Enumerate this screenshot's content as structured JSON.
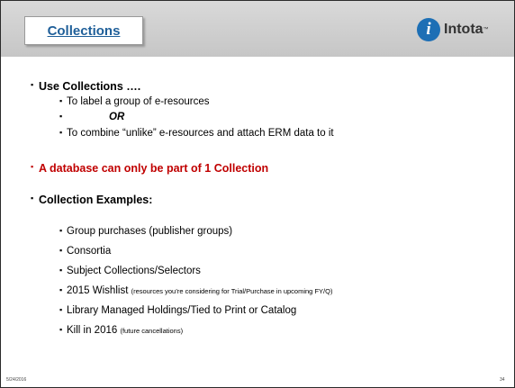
{
  "header": {
    "title": "Collections",
    "logo_text": "Intota",
    "logo_tm": "™",
    "logo_icon": "info-i"
  },
  "bullets": [
    {
      "text": "Use Collections ….",
      "color": "#000000"
    },
    {
      "sub": [
        {
          "text": "To label a group of e-resources"
        },
        {
          "text": "OR"
        },
        {
          "text": "To combine “unlike” e-resources  and attach ERM data to it"
        }
      ]
    },
    {
      "text": "A database can only be part of 1 Collection",
      "color": "#c00000"
    },
    {
      "text": "Collection Examples:",
      "color": "#000000"
    },
    {
      "sub": [
        {
          "text": "Group purchases (publisher groups)"
        },
        {
          "text": "Consortia"
        },
        {
          "text": "Subject Collections/Selectors"
        },
        {
          "text": "2015 Wishlist",
          "note": "(resources you’re considering for Trial/Purchase in upcoming FY/Q)"
        },
        {
          "text": "Library Managed Holdings/Tied to Print or Catalog"
        },
        {
          "text": "Kill in 2016",
          "note": "(future cancellations)"
        }
      ]
    }
  ],
  "footer": {
    "date": "5/24/2016",
    "page": "34"
  },
  "colors": {
    "title": "#1f5f99",
    "accent_red": "#c00000",
    "logo_blue": "#1d6fb5"
  }
}
